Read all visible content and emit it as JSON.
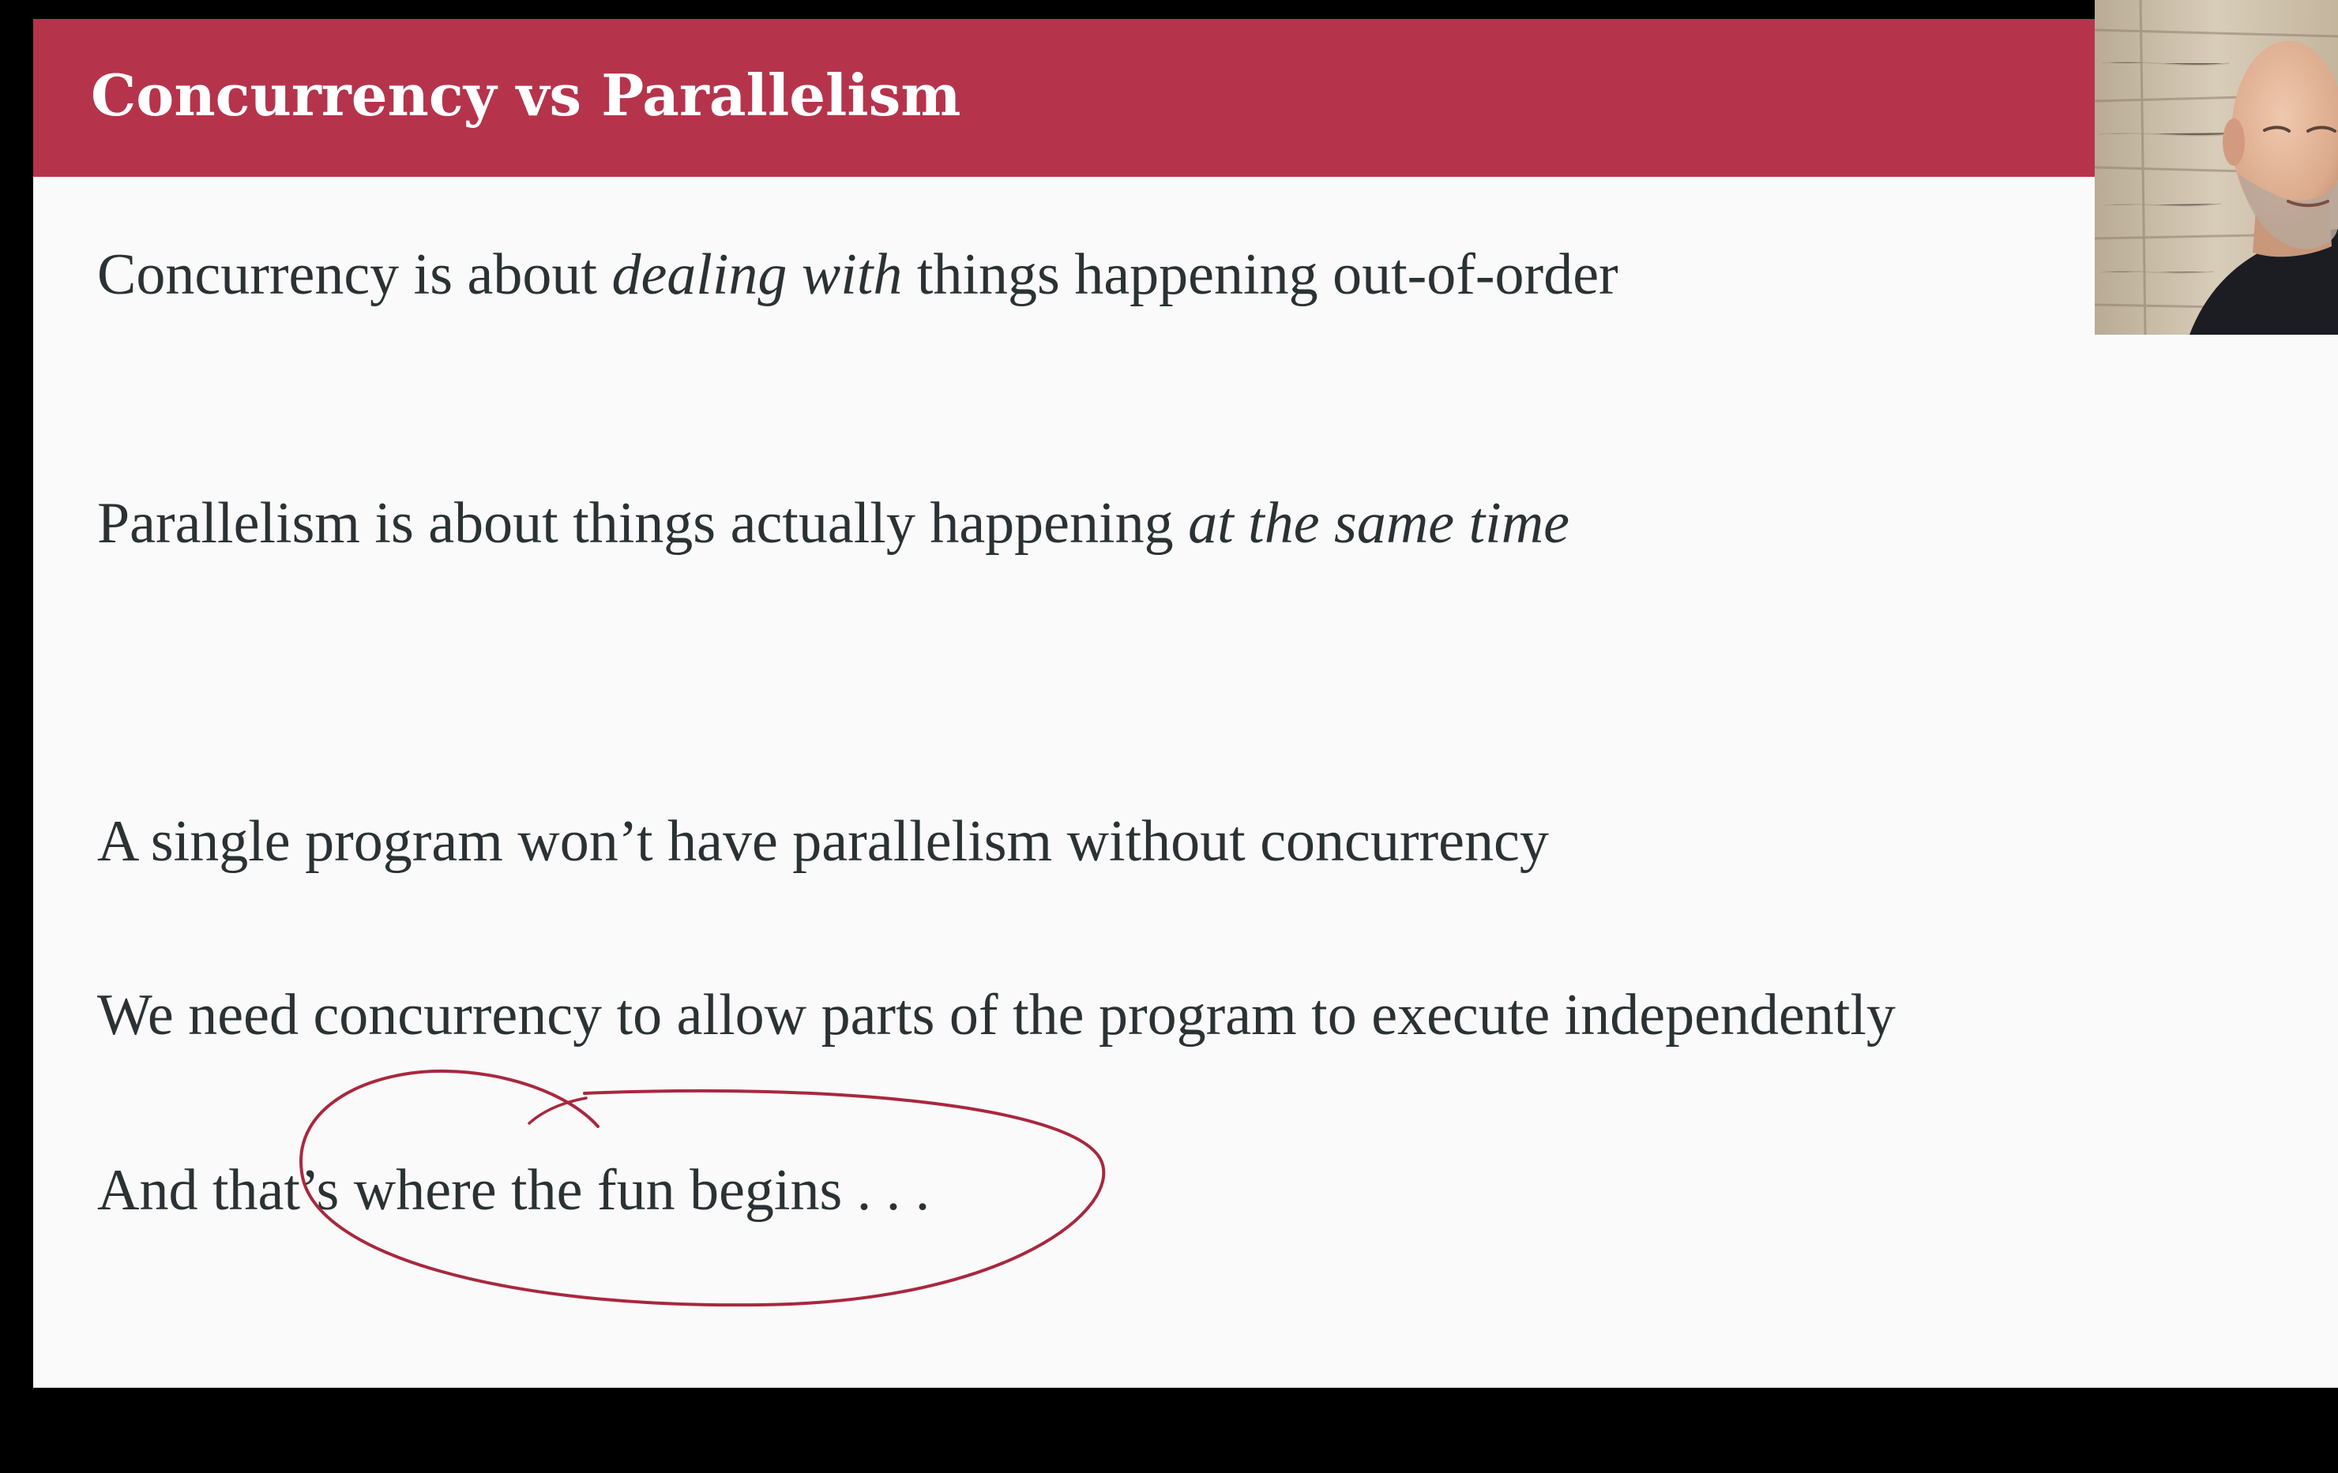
{
  "slide": {
    "title": "Concurrency vs Parallelism",
    "line1": {
      "before": "Concurrency is about ",
      "emphasis": "dealing with",
      "after": " things happening out-of-order"
    },
    "line2": {
      "before": "Parallelism is about things actually happening ",
      "emphasis": "at the same time"
    },
    "line3": "A single program won’t have parallelism without concurrency",
    "line4": "We need concurrency to allow parts of the program to execute independently",
    "line5": "And that’s where the fun begins . . ."
  },
  "colors": {
    "title_bar": "#b5344b",
    "body_text": "#2a3233",
    "annotation_ink": "#a8283e",
    "slide_background": "#fafafa",
    "frame": "#000000"
  },
  "icons": {
    "annotation": "hand-drawn-circle",
    "presenter": "presenter-webcam"
  }
}
